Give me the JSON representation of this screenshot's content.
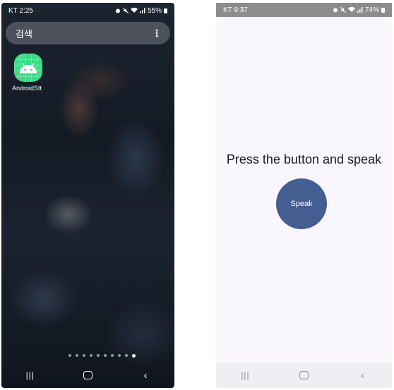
{
  "left_screen": {
    "status_bar": {
      "carrier_time": "KT 2:25",
      "battery": "55%"
    },
    "search": {
      "label": "검색"
    },
    "apps": [
      {
        "label": "AndroidStt",
        "icon": "android-icon",
        "color": "#3ddc84"
      }
    ],
    "page_dots": {
      "count": 10,
      "active_index": 9
    },
    "nav": {
      "recents": "|||",
      "home": "○",
      "back": "‹"
    }
  },
  "right_screen": {
    "status_bar": {
      "carrier_time": "KT 9:37",
      "battery": "74%"
    },
    "prompt": "Press the button and speak",
    "speak_button": {
      "label": "Speak",
      "color": "#445e91"
    },
    "nav": {
      "recents": "|||",
      "home": "○",
      "back": "‹"
    }
  }
}
